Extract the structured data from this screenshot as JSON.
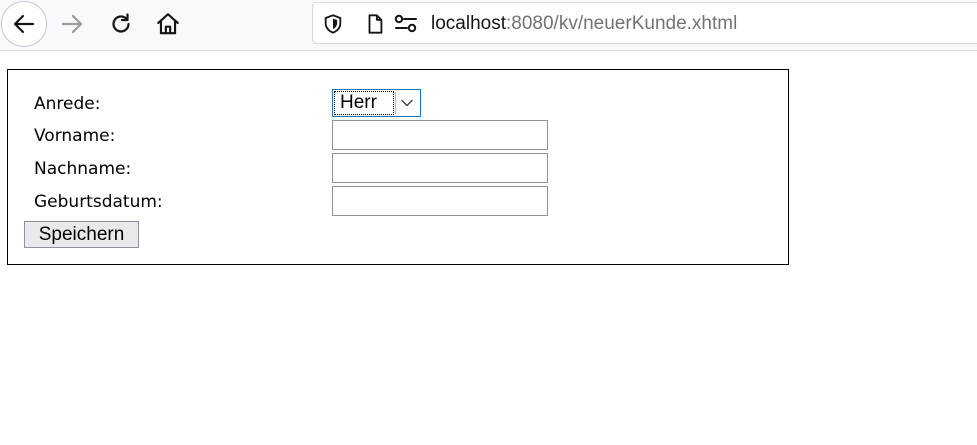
{
  "browser": {
    "url_host": "localhost",
    "url_rest": ":8080/kv/neuerKunde.xhtml",
    "icons": {
      "back": "back-arrow-icon",
      "forward": "forward-arrow-icon",
      "reload": "reload-icon",
      "home": "home-icon",
      "shield": "shield-icon",
      "page": "page-icon",
      "permissions": "permissions-icon"
    },
    "colors": {
      "toolbar_bg": "#f9f9fb",
      "url_host": "#15141a",
      "url_rest": "#737373",
      "select_focus_border": "#1a73b5"
    }
  },
  "form": {
    "salutation_label": "Anrede:",
    "salutation_value": "Herr",
    "firstname_label": "Vorname:",
    "firstname_value": "",
    "lastname_label": "Nachname:",
    "lastname_value": "",
    "birthdate_label": "Geburtsdatum:",
    "birthdate_value": "",
    "save_label": "Speichern"
  }
}
